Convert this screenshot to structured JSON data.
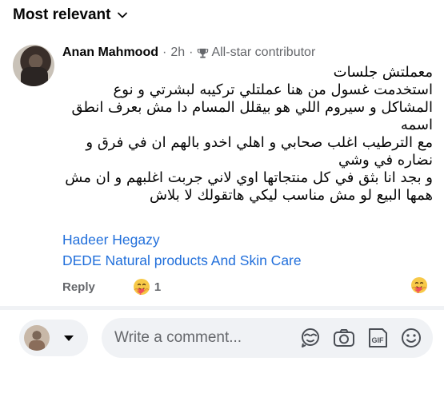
{
  "sort": {
    "label": "Most relevant"
  },
  "comment": {
    "author": "Anan Mahmood",
    "separator": "·",
    "time": "2h",
    "separator2": "·",
    "badge": "All-star contributor",
    "lines": [
      "معملتش جلسات",
      "استخدمت غسول من هنا عملتلي تركيبه لبشرتي و نوع المشاكل  و سيروم اللي هو بيقلل المسام دا مش بعرف انطق اسمه",
      "مع الترطيب اغلب صحابي و اهلي اخدو بالهم ان في فرق و نضاره في وشي",
      "و بجد انا بثق في كل منتجاتها اوي لاني جربت اغلبهم و ان مش همها البيع لو مش مناسب ليكي هاتقولك لا بلاش"
    ],
    "tags": [
      "Hadeer Hegazy",
      "DEDE Natural products And Skin Care"
    ],
    "reply_label": "Reply",
    "reaction_count": "1"
  },
  "composer": {
    "placeholder": "Write a comment..."
  },
  "icons": {
    "sort": "chevron-down-icon",
    "badge": "trophy-icon",
    "reaction": "care-emoji-icon",
    "avatar_sticker": "avatar-sticker-icon",
    "camera": "camera-icon",
    "gif": "gif-icon",
    "emoji": "smiley-icon"
  },
  "colors": {
    "link": "#216fdb",
    "secondary_text": "#65676b",
    "input_bg": "#f0f2f5"
  }
}
